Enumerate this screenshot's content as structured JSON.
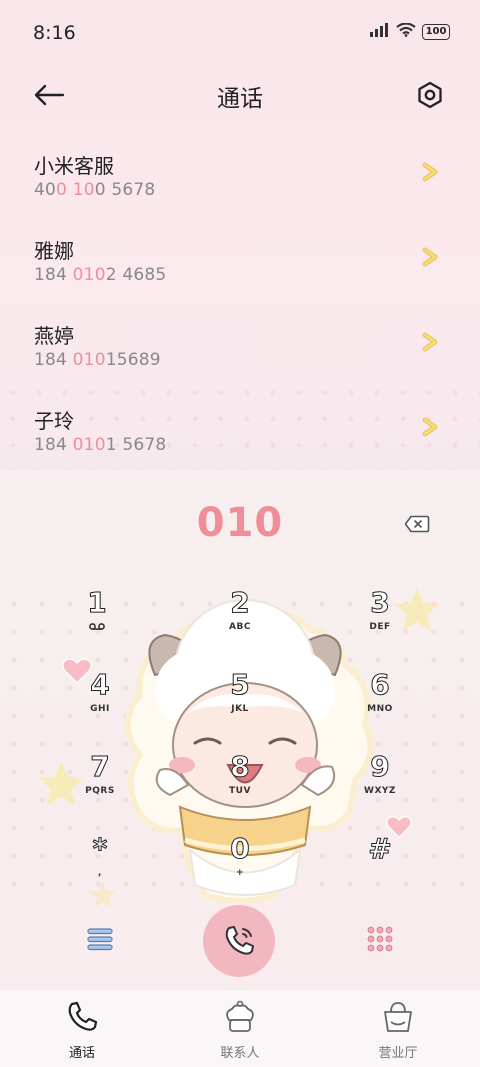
{
  "status_bar": {
    "time": "8:16",
    "battery": "100"
  },
  "header": {
    "title": "通话"
  },
  "contacts": [
    {
      "name": "小米客服",
      "number_parts": [
        "40",
        "0",
        " ",
        "10",
        "0 5678"
      ],
      "highlight": [
        false,
        true,
        false,
        true,
        false
      ]
    },
    {
      "name": "雅娜",
      "number_parts": [
        "184 ",
        "010",
        "2 4685"
      ],
      "highlight": [
        false,
        true,
        false
      ]
    },
    {
      "name": "燕婷",
      "number_parts": [
        "184 ",
        "010",
        "15689"
      ],
      "highlight": [
        false,
        true,
        false
      ]
    },
    {
      "name": "子玲",
      "number_parts": [
        "184 ",
        "010",
        "1 5678"
      ],
      "highlight": [
        false,
        true,
        false
      ]
    }
  ],
  "dialer": {
    "input": "010"
  },
  "keypad": [
    {
      "digit": "1",
      "letters": ""
    },
    {
      "digit": "2",
      "letters": "ABC"
    },
    {
      "digit": "3",
      "letters": "DEF"
    },
    {
      "digit": "4",
      "letters": "GHI"
    },
    {
      "digit": "5",
      "letters": "JKL"
    },
    {
      "digit": "6",
      "letters": "MNO"
    },
    {
      "digit": "7",
      "letters": "PQRS"
    },
    {
      "digit": "8",
      "letters": "TUV"
    },
    {
      "digit": "9",
      "letters": "WXYZ"
    },
    {
      "digit": "*",
      "letters": ","
    },
    {
      "digit": "0",
      "letters": "+"
    },
    {
      "digit": "#",
      "letters": ""
    }
  ],
  "bottom_nav": [
    {
      "label": "通话",
      "icon": "phone-icon",
      "active": true
    },
    {
      "label": "联系人",
      "icon": "chef-hat-icon",
      "active": false
    },
    {
      "label": "营业厅",
      "icon": "basket-icon",
      "active": false
    }
  ],
  "colors": {
    "accent_pink": "#ef8e98",
    "highlight": "#ee8e9a",
    "chevron": "#f1d36a",
    "call_button": "#f2b7c0"
  }
}
